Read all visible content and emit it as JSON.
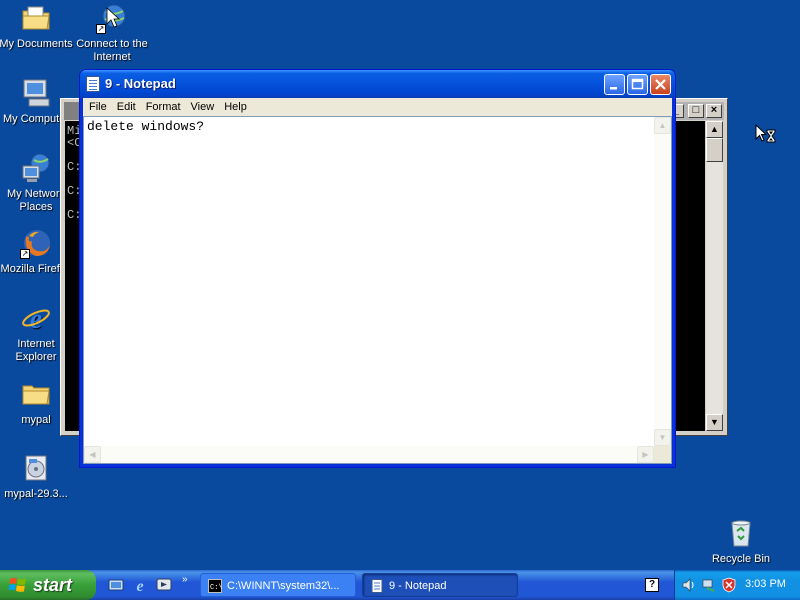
{
  "desktop": {
    "icons": [
      {
        "label": "My Documents",
        "icon": "folder-documents-icon"
      },
      {
        "label": "Connect to the Internet",
        "icon": "connect-internet-icon"
      },
      {
        "label": "My Computer",
        "icon": "computer-icon"
      },
      {
        "label": "My Network Places",
        "icon": "network-places-icon"
      },
      {
        "label": "Mozilla Firefox",
        "icon": "firefox-icon"
      },
      {
        "label": "Internet Explorer",
        "icon": "internet-explorer-icon"
      },
      {
        "label": "mypal",
        "icon": "folder-icon"
      },
      {
        "label": "mypal-29.3...",
        "icon": "installer-icon"
      },
      {
        "label": "Recycle Bin",
        "icon": "recycle-bin-icon"
      }
    ]
  },
  "console_window": {
    "visible_text": "Mi\n<C\n\nC:\n\nC:\n\nC:"
  },
  "notepad": {
    "title": "9 - Notepad",
    "menu": [
      "File",
      "Edit",
      "Format",
      "View",
      "Help"
    ],
    "content": "delete windows?"
  },
  "taskbar": {
    "start_label": "start",
    "quick_launch": [
      "show-desktop-icon",
      "internet-explorer-icon",
      "windows-media-icon"
    ],
    "tasks": [
      {
        "label": "C:\\WINNT\\system32\\...",
        "icon": "console-icon",
        "active": false
      },
      {
        "label": "9 - Notepad",
        "icon": "notepad-icon",
        "active": true
      }
    ],
    "tray_icons": [
      "volume-icon",
      "network-icon",
      "security-shield-icon"
    ],
    "clock": "3:03 PM"
  },
  "colors": {
    "desktop": "#0a4a9e",
    "titlebar_active": "#0551db",
    "start_green": "#39a039",
    "taskbar_blue": "#2157d7"
  }
}
